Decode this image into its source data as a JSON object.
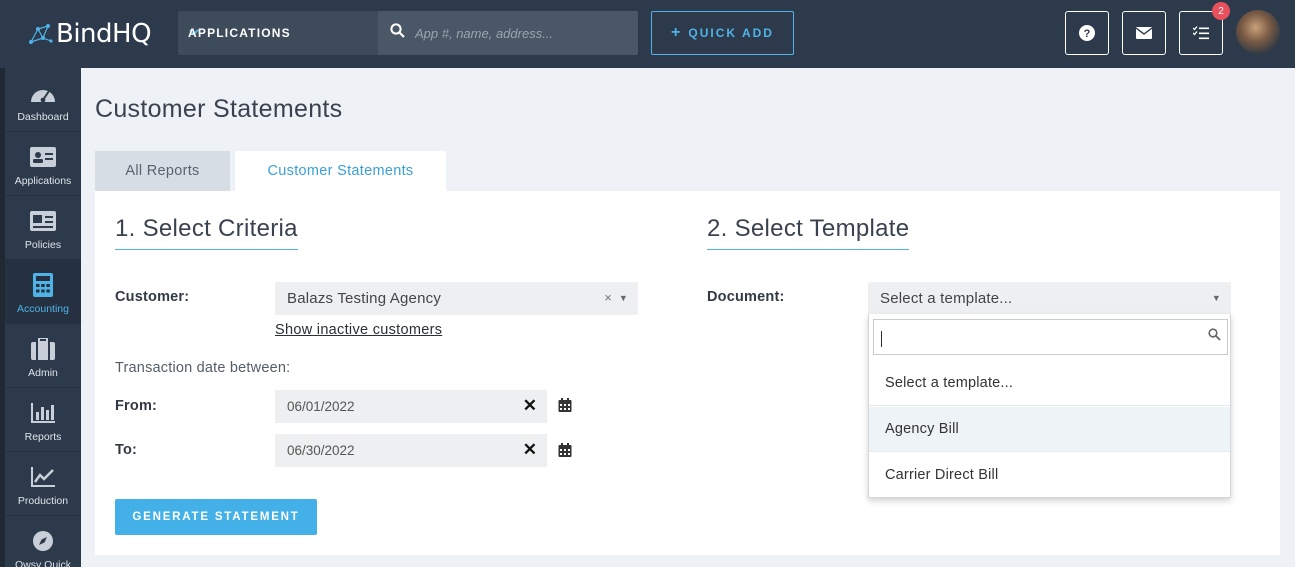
{
  "brand": {
    "name": "BindHQ"
  },
  "topbar": {
    "apps_label": "APPLICATIONS",
    "search_placeholder": "App #, name, address...",
    "quick_add_label": "QUICK ADD",
    "tasks_badge": "2"
  },
  "sidebar": {
    "items": [
      {
        "label": "Dashboard",
        "icon": "dashboard-gauge-icon"
      },
      {
        "label": "Applications",
        "icon": "id-card-icon"
      },
      {
        "label": "Policies",
        "icon": "document-card-icon"
      },
      {
        "label": "Accounting",
        "icon": "calculator-icon",
        "active": true
      },
      {
        "label": "Admin",
        "icon": "briefcase-icon"
      },
      {
        "label": "Reports",
        "icon": "bar-chart-icon"
      },
      {
        "label": "Production",
        "icon": "line-chart-icon"
      },
      {
        "label": "Owsy Quick",
        "icon": "compass-icon"
      }
    ]
  },
  "page": {
    "title": "Customer Statements",
    "tabs": [
      {
        "label": "All Reports"
      },
      {
        "label": "Customer Statements",
        "active": true
      }
    ]
  },
  "criteria": {
    "heading": "1. Select Criteria",
    "customer_label": "Customer:",
    "customer_value": "Balazs Testing Agency",
    "clear_glyph": "×",
    "show_inactive_link": "Show inactive customers",
    "date_heading": "Transaction date between:",
    "from_label": "From:",
    "from_value": "06/01/2022",
    "to_label": "To:",
    "to_value": "06/30/2022",
    "generate_label": "GENERATE STATEMENT"
  },
  "template": {
    "heading": "2. Select Template",
    "document_label": "Document:",
    "document_value": "Select a template...",
    "dropdown_search_value": "",
    "options": [
      {
        "label": "Select a template...",
        "highlighted": false
      },
      {
        "label": "Agency Bill",
        "highlighted": true
      },
      {
        "label": "Carrier Direct Bill",
        "highlighted": false
      }
    ]
  },
  "colors": {
    "topbar": "#2d3a4b",
    "accent": "#4fb3e8",
    "badge": "#e8505b",
    "button": "#43b0e8"
  }
}
